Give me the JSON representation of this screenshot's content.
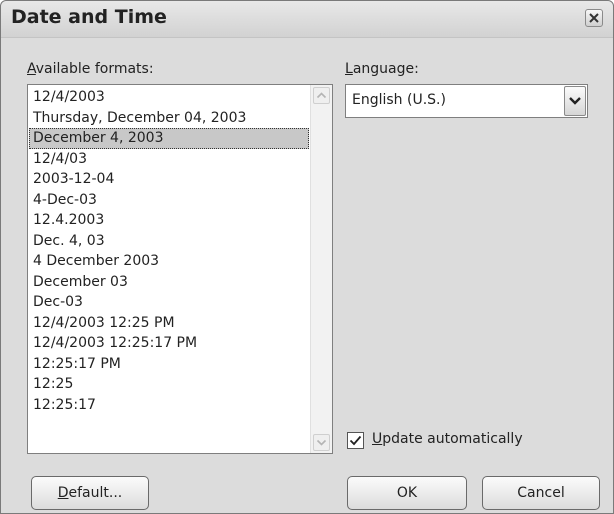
{
  "dialog": {
    "title": "Date and Time"
  },
  "formats": {
    "label_accel": "A",
    "label_rest": "vailable formats:",
    "items": [
      "12/4/2003",
      "Thursday, December 04, 2003",
      "December 4, 2003",
      "12/4/03",
      "2003-12-04",
      "4-Dec-03",
      "12.4.2003",
      "Dec. 4, 03",
      "4 December 2003",
      "December 03",
      "Dec-03",
      "12/4/2003 12:25 PM",
      "12/4/2003 12:25:17 PM",
      "12:25:17 PM",
      "12:25",
      "12:25:17"
    ],
    "selected": "December 4, 2003"
  },
  "language": {
    "label_accel": "L",
    "label_rest": "anguage:",
    "value": "English (U.S.)"
  },
  "update": {
    "label_accel": "U",
    "label_rest": "pdate automatically",
    "checked": true
  },
  "buttons": {
    "default_accel": "D",
    "default_rest": "efault...",
    "ok": "OK",
    "cancel": "Cancel"
  },
  "icons": [
    "close-icon",
    "scroll-up-arrow-icon",
    "scroll-down-arrow-icon",
    "dropdown-arrow-icon",
    "checkmark-icon"
  ]
}
